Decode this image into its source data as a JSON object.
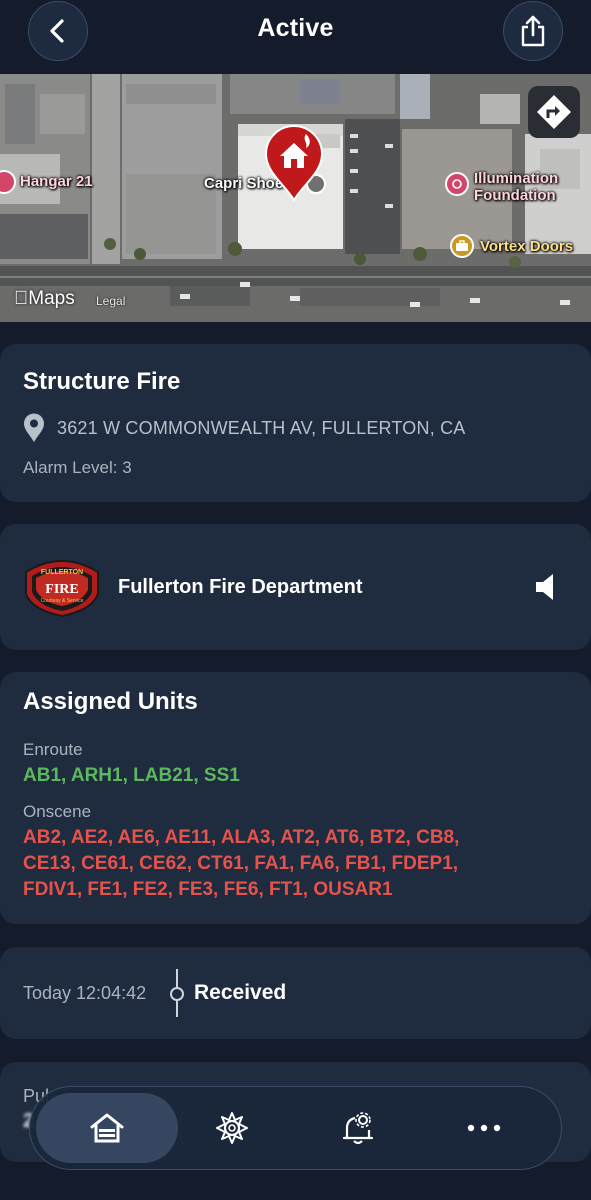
{
  "header": {
    "title": "Active"
  },
  "map": {
    "labels": {
      "hangar": "Hangar 21",
      "capri": "Capri Shoes",
      "illumination_line1": "Illumination",
      "illumination_line2": "Foundation",
      "vortex": "Vortex Doors"
    },
    "maps_brand": "Maps",
    "legal": "Legal"
  },
  "incident": {
    "type": "Structure Fire",
    "address": "3621 W COMMONWEALTH AV, FULLERTON, CA",
    "alarm_level": "Alarm Level: 3"
  },
  "department": {
    "name": "Fullerton Fire Department",
    "logo_text_top": "FULLERTON",
    "logo_text_mid": "FIRE",
    "logo_text_bottom": "Courtesy & Service"
  },
  "units": {
    "title": "Assigned Units",
    "enroute_label": "Enroute",
    "enroute": "AB1, ARH1, LAB21, SS1",
    "onscene_label": "Onscene",
    "onscene_line1": "AB2, AE2, AE6, AE11, ALA3, AT2, AT6, BT2, CB8,",
    "onscene_line2": "CE13, CE61, CE62, CT61, FA1, FA6, FB1, FDEP1,",
    "onscene_line3": "FDIV1, FE1, FE2, FE3, FE6, FT1, OUSAR1"
  },
  "timeline": {
    "time": "Today 12:04:42",
    "status": "Received"
  },
  "pulse": {
    "label": "Pul",
    "value": "2"
  },
  "tabbar": {
    "items": [
      "home-icon",
      "fire-badge-icon",
      "alert-settings-icon",
      "more-icon"
    ]
  },
  "colors": {
    "background": "#141c2b",
    "card": "#1f2b3f",
    "enroute": "#5cb85c",
    "onscene": "#e5534b",
    "pin": "#c0191c"
  }
}
